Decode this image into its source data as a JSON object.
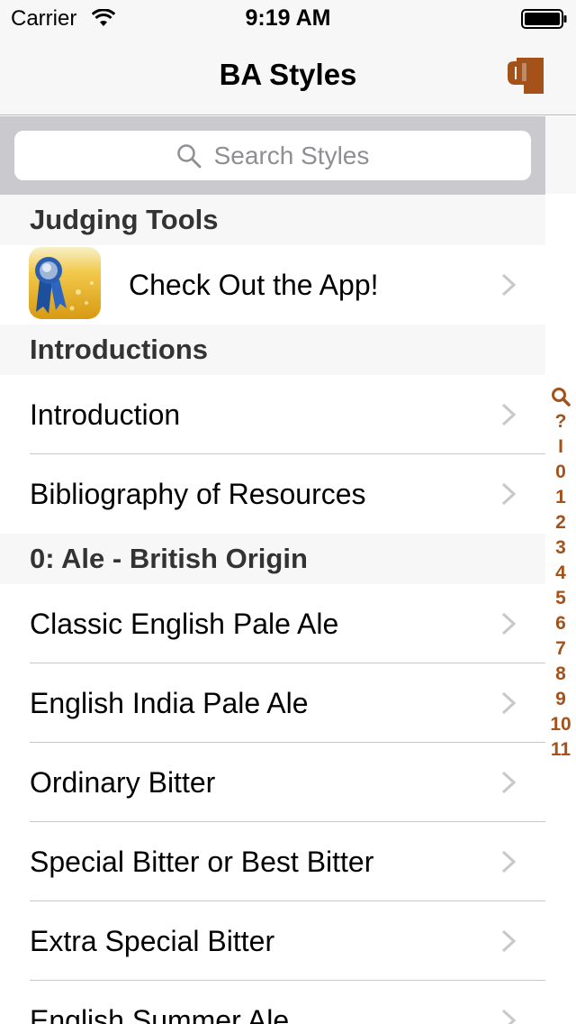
{
  "status_bar": {
    "carrier": "Carrier",
    "time": "9:19 AM"
  },
  "nav": {
    "title": "BA Styles",
    "right_icon": "beer-mug-icon"
  },
  "search": {
    "placeholder": "Search Styles"
  },
  "sections": [
    {
      "header": "Judging Tools",
      "rows": [
        {
          "label": "Check Out the App!",
          "icon": "app-ribbon-icon"
        }
      ]
    },
    {
      "header": "Introductions",
      "rows": [
        {
          "label": "Introduction"
        },
        {
          "label": "Bibliography of Resources"
        }
      ]
    },
    {
      "header": "0: Ale - British Origin",
      "rows": [
        {
          "label": "Classic English Pale Ale"
        },
        {
          "label": "English India Pale Ale"
        },
        {
          "label": "Ordinary Bitter"
        },
        {
          "label": "Special Bitter or Best Bitter"
        },
        {
          "label": "Extra Special Bitter"
        },
        {
          "label": "English Summer Ale"
        }
      ]
    }
  ],
  "section_index": [
    "?",
    "I",
    "0",
    "1",
    "2",
    "3",
    "4",
    "5",
    "6",
    "7",
    "8",
    "9",
    "10",
    "11"
  ],
  "colors": {
    "accent": "#a5511a",
    "bar_background": "#f7f7f7",
    "search_background": "#c9c9ce"
  }
}
